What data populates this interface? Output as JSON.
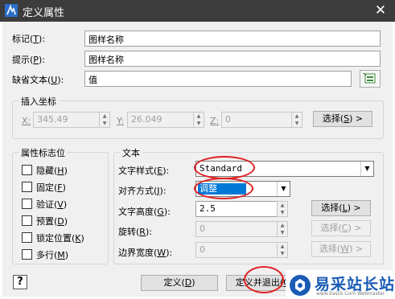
{
  "window": {
    "title": "定义属性",
    "close": "✕"
  },
  "attributes": {
    "tag": {
      "label": "标记",
      "key": "T",
      "value": "图样名称"
    },
    "prompt": {
      "label": "提示",
      "key": "P",
      "value": "图样名称"
    },
    "default": {
      "label": "缺省文本",
      "key": "U",
      "value": "值"
    }
  },
  "insert": {
    "title": "插入坐标",
    "x": {
      "label": "X",
      "value": "345.49"
    },
    "y": {
      "label": "Y",
      "value": "26.049"
    },
    "z": {
      "label": "Z",
      "value": "0"
    },
    "select": {
      "label": "选择",
      "key": "S",
      "arrow": ">"
    }
  },
  "flags": {
    "title": "属性标志位",
    "items": [
      {
        "label": "隐藏",
        "key": "H"
      },
      {
        "label": "固定",
        "key": "F"
      },
      {
        "label": "验证",
        "key": "V"
      },
      {
        "label": "预置",
        "key": "D"
      },
      {
        "label": "锁定位置",
        "key": "K"
      },
      {
        "label": "多行",
        "key": "M"
      }
    ]
  },
  "text": {
    "title": "文本",
    "style": {
      "label": "文字样式",
      "key": "E",
      "value": "Standard"
    },
    "justify": {
      "label": "对齐方式",
      "key": "J",
      "value": "调整"
    },
    "height": {
      "label": "文字高度",
      "key": "G",
      "value": "2.5",
      "select": "选择",
      "select_key": "L"
    },
    "rotation": {
      "label": "旋转",
      "key": "R",
      "value": "0",
      "select": "选择",
      "select_key": "C"
    },
    "border": {
      "label": "边界宽度",
      "key": "W",
      "value": "0",
      "select": "选择",
      "select_key": "W"
    }
  },
  "buttons": {
    "help": "?",
    "define": {
      "label": "定义",
      "key": "D"
    },
    "define_exit": {
      "label": "定义并退出",
      "key": "Q"
    }
  },
  "watermark": {
    "text": "易采站长站",
    "url": "www.Easck.Com Webmaster"
  },
  "colors": {
    "titlebar": "#3c3c3c",
    "highlight": "#0078d7",
    "annotation": "#e02020",
    "watermark": "#1a5bb5"
  }
}
